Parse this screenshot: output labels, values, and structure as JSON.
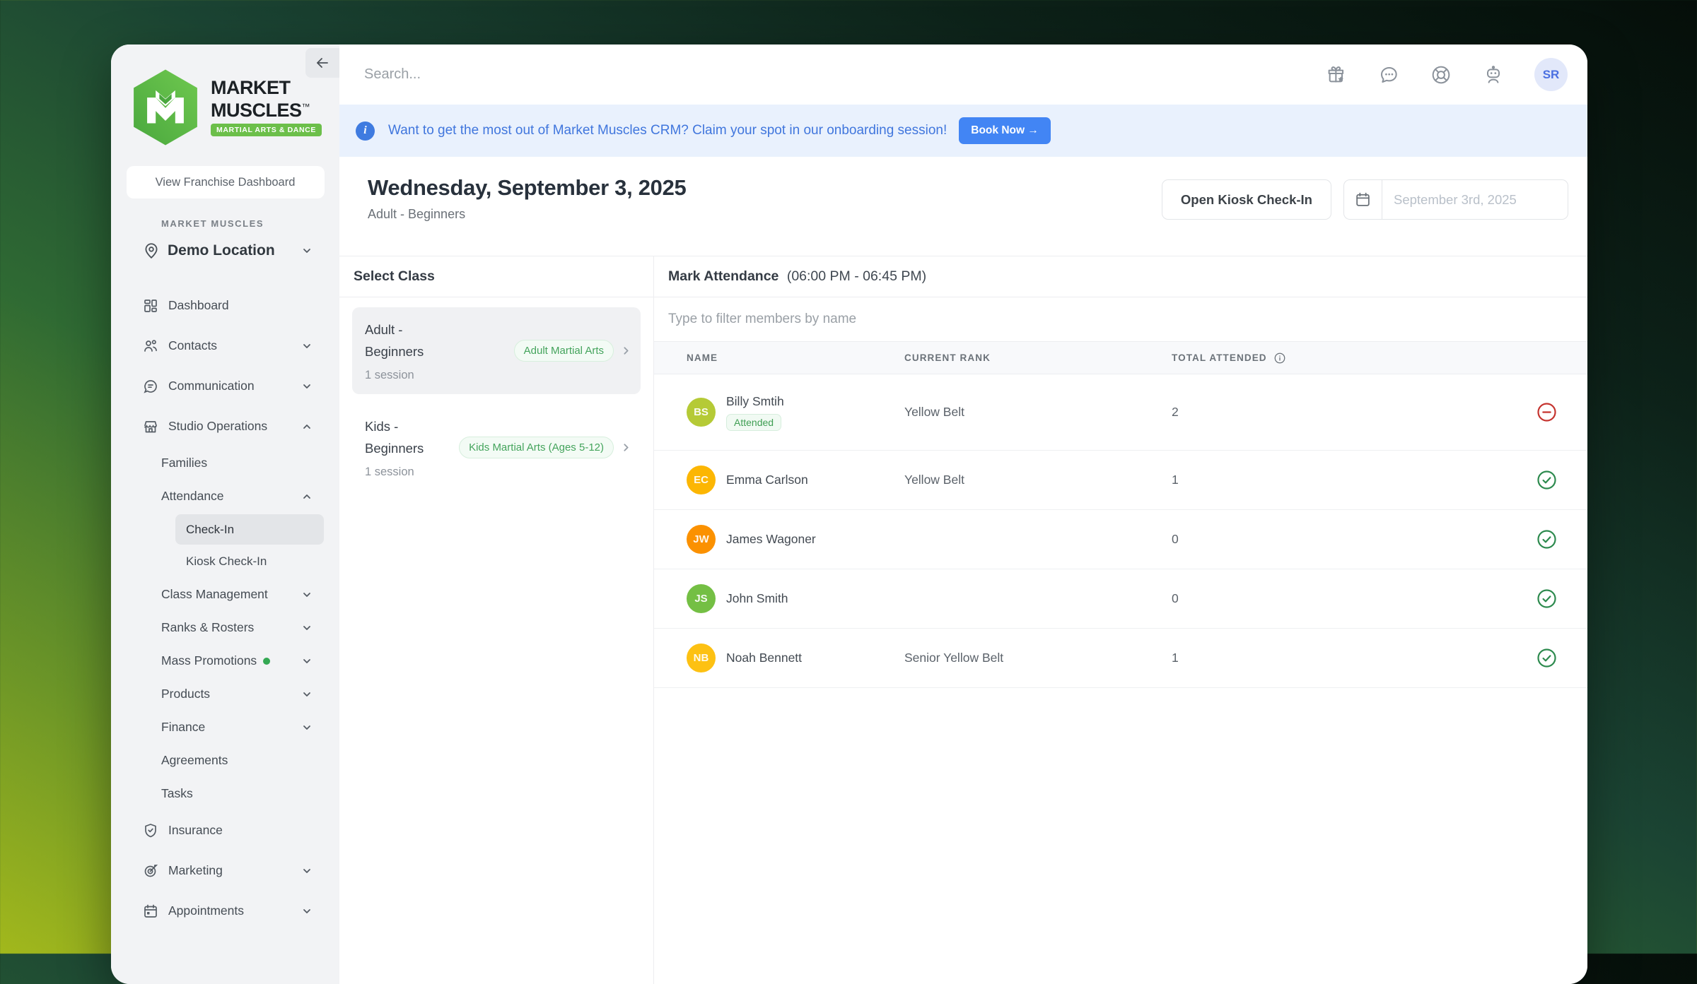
{
  "colors": {
    "accent_blue": "#4285f4",
    "banner_text": "#4076dd",
    "badge_green": "#44a45c",
    "success_green": "#2d8a4e",
    "danger_red": "#c5342f",
    "mass_promotions_dot": "#34a853",
    "logo_green": "#6cbf4a"
  },
  "sidebar": {
    "logo": {
      "title_line1": "MARKET",
      "title_line2": "MUSCLES",
      "trademark": "™",
      "badge": "MARTIAL ARTS & DANCE"
    },
    "franchise_button_label": "View Franchise Dashboard",
    "org_label": "MARKET MUSCLES",
    "location_name": "Demo Location",
    "nav": {
      "dashboard": "Dashboard",
      "contacts": "Contacts",
      "communication": "Communication",
      "studio_operations": "Studio Operations",
      "families": "Families",
      "attendance": "Attendance",
      "check_in": "Check-In",
      "kiosk_check_in": "Kiosk Check-In",
      "class_management": "Class Management",
      "ranks_rosters": "Ranks & Rosters",
      "mass_promotions": "Mass Promotions",
      "products": "Products",
      "finance": "Finance",
      "agreements": "Agreements",
      "tasks": "Tasks",
      "insurance": "Insurance",
      "marketing": "Marketing",
      "appointments": "Appointments"
    }
  },
  "topbar": {
    "search_placeholder": "Search...",
    "avatar_initials": "SR"
  },
  "banner": {
    "message": "Want to get the most out of Market Muscles CRM? Claim your spot in our onboarding session!",
    "button_label": "Book Now →"
  },
  "header": {
    "title": "Wednesday, September 3, 2025",
    "subtitle": "Adult - Beginners",
    "kiosk_button_label": "Open Kiosk Check-In",
    "date_placeholder": "September 3rd, 2025"
  },
  "class_panel": {
    "title": "Select Class",
    "classes": [
      {
        "name": "Adult - Beginners",
        "sessions": "1 session",
        "category_badge": "Adult Martial Arts",
        "selected": true
      },
      {
        "name": "Kids - Beginners",
        "sessions": "1 session",
        "category_badge": "Kids Martial Arts (Ages 5-12)",
        "selected": false
      }
    ]
  },
  "attendance": {
    "title": "Mark Attendance",
    "time_range": "(06:00 PM - 06:45 PM)",
    "filter_placeholder": "Type to filter members by name",
    "columns": [
      "NAME",
      "CURRENT RANK",
      "TOTAL ATTENDED"
    ],
    "members": [
      {
        "initials": "BS",
        "name": "Billy Smtih",
        "status_badge": "Attended",
        "rank": "Yellow Belt",
        "total": "2",
        "avatar_color": "#b5ca36",
        "action": "remove"
      },
      {
        "initials": "EC",
        "name": "Emma Carlson",
        "rank": "Yellow Belt",
        "total": "1",
        "avatar_color": "#fcb603",
        "action": "check"
      },
      {
        "initials": "JW",
        "name": "James Wagoner",
        "rank": "",
        "total": "0",
        "avatar_color": "#fb9100",
        "action": "check"
      },
      {
        "initials": "JS",
        "name": "John Smith",
        "rank": "",
        "total": "0",
        "avatar_color": "#74bf44",
        "action": "check"
      },
      {
        "initials": "NB",
        "name": "Noah Bennett",
        "rank": "Senior Yellow Belt",
        "total": "1",
        "avatar_color": "#fdc113",
        "action": "check"
      }
    ]
  }
}
